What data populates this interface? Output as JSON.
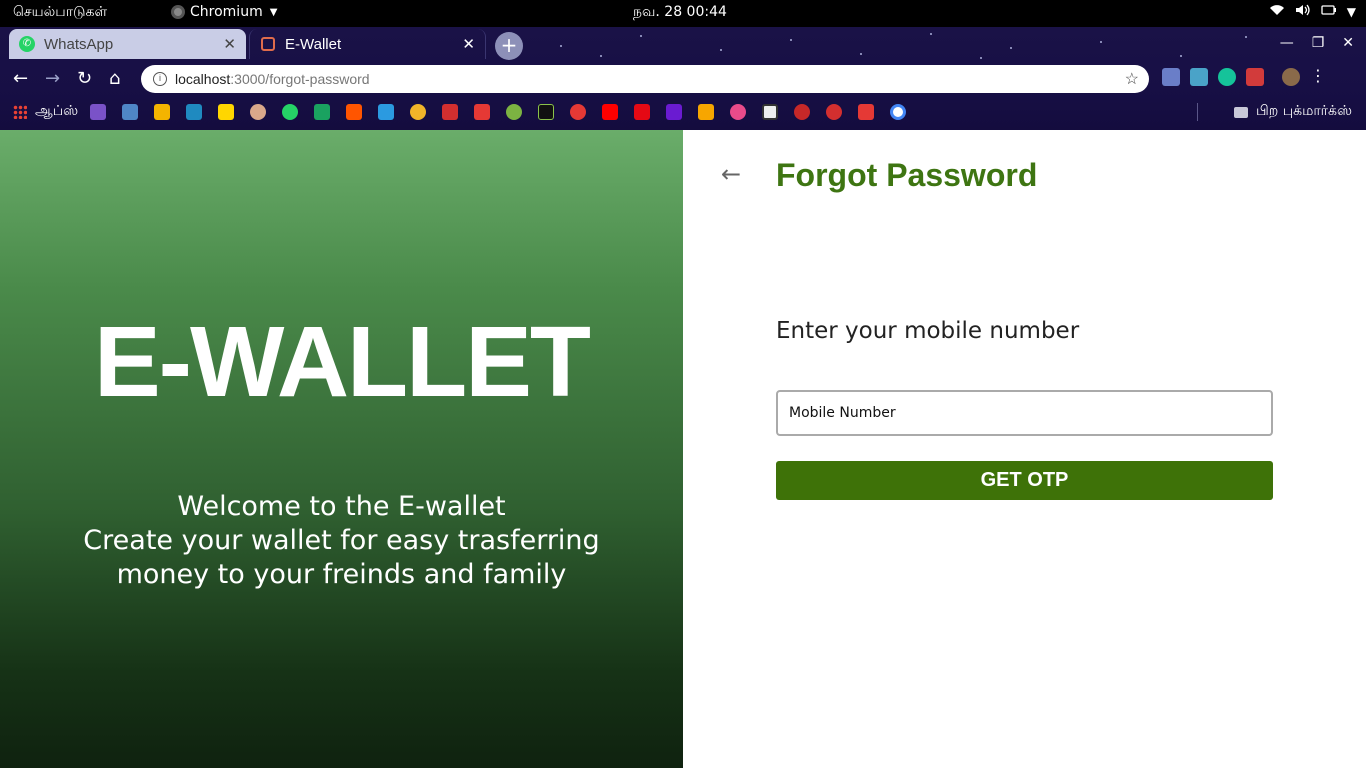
{
  "system_bar": {
    "activities_label": "செயல்பாடுகள்",
    "app_name": "Chromium",
    "clock": "நவ. 28  00:44"
  },
  "browser": {
    "tabs": [
      {
        "title": "WhatsApp",
        "icon": "whatsapp-icon",
        "active": false
      },
      {
        "title": "E-Wallet",
        "icon": "ewallet-favicon",
        "active": true
      }
    ],
    "address": {
      "host": "localhost",
      "path": ":3000/forgot-password"
    },
    "bookmarks_apps_label": "ஆப்ஸ்",
    "other_bookmarks_label": "பிற புக்மார்க்ஸ்"
  },
  "left_panel": {
    "brand": "E-WALLET",
    "welcome_lines": [
      "Welcome to the E-wallet",
      "Create your wallet for easy trasferring",
      "money to your freinds and family"
    ]
  },
  "form": {
    "title": "Forgot Password",
    "prompt": "Enter your mobile number",
    "mobile_placeholder": "Mobile Number",
    "submit_label": "GET OTP"
  },
  "colors": {
    "accent_green": "#3e7512",
    "button_green": "#3e7208",
    "chrome_bg": "#1a1247"
  }
}
